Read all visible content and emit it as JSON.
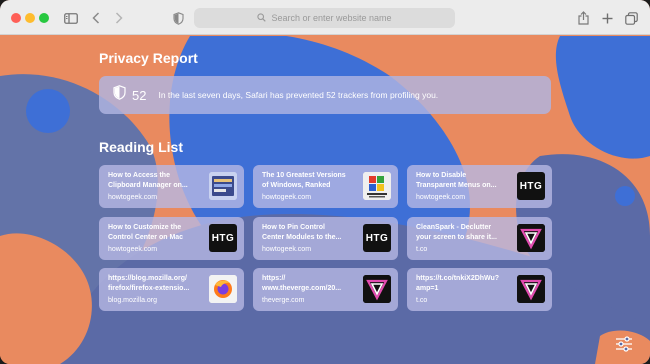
{
  "toolbar": {
    "address_placeholder": "Search or enter website name"
  },
  "privacy_report": {
    "heading": "Privacy Report",
    "count": "52",
    "message": "In the last seven days, Safari has prevented 52 trackers from profiling you."
  },
  "reading_list": {
    "heading": "Reading List",
    "items": [
      {
        "title_line1": "How to Access the",
        "title_line2": "Clipboard Manager on...",
        "domain": "howtogeek.com",
        "thumb": "clipboard-screenshot"
      },
      {
        "title_line1": "The 10 Greatest Versions",
        "title_line2": "of Windows, Ranked",
        "domain": "howtogeek.com",
        "thumb": "windows-logo"
      },
      {
        "title_line1": "How to Disable",
        "title_line2": "Transparent Menus on...",
        "domain": "howtogeek.com",
        "thumb": "htg-logo",
        "thumb_text": "HTG"
      },
      {
        "title_line1": "How to Customize the",
        "title_line2": "Control Center on Mac",
        "domain": "howtogeek.com",
        "thumb": "htg-logo",
        "thumb_text": "HTG"
      },
      {
        "title_line1": "How to Pin Control",
        "title_line2": "Center Modules to the...",
        "domain": "howtogeek.com",
        "thumb": "htg-logo",
        "thumb_text": "HTG"
      },
      {
        "title_line1": "CleanSpark - Declutter",
        "title_line2": "your screen to share it...",
        "domain": "t.co",
        "thumb": "verge-logo"
      },
      {
        "title_line1": "https://blog.mozilla.org/",
        "title_line2": "firefox/firefox-extensio...",
        "domain": "blog.mozilla.org",
        "thumb": "firefox-logo"
      },
      {
        "title_line1": "https://",
        "title_line2": "www.theverge.com/20...",
        "domain": "theverge.com",
        "thumb": "verge-logo"
      },
      {
        "title_line1": "https://t.co/tnkiX2DhWu?",
        "title_line2": "amp=1",
        "domain": "t.co",
        "thumb": "verge-logo"
      }
    ]
  },
  "colors": {
    "background": "#e98a5f",
    "blob_blue": "#3e6fd6",
    "blob_slate": "#6373a8",
    "card": "#b6b8e4"
  }
}
